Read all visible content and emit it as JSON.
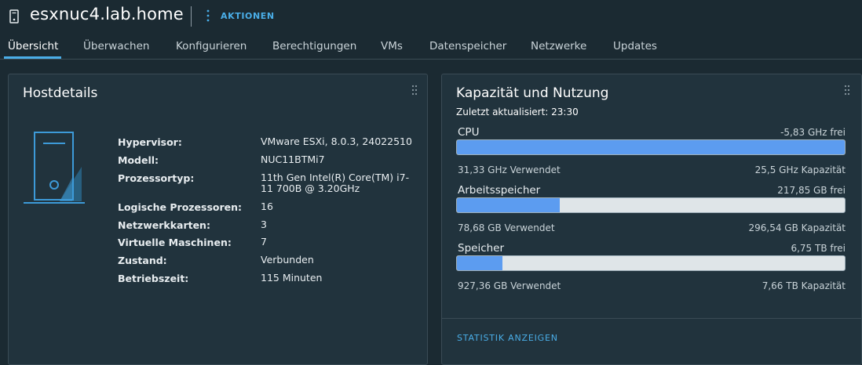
{
  "header": {
    "host_name": "esxnuc4.lab.home",
    "actions_label": "AKTIONEN",
    "icon": "host-icon"
  },
  "tabs": [
    {
      "label": "Übersicht",
      "active": true
    },
    {
      "label": "Überwachen"
    },
    {
      "label": "Konfigurieren"
    },
    {
      "label": "Berechtigungen"
    },
    {
      "label": "VMs"
    },
    {
      "label": "Datenspeicher"
    },
    {
      "label": "Netzwerke"
    },
    {
      "label": "Updates"
    }
  ],
  "host_details": {
    "title": "Hostdetails",
    "rows": [
      {
        "label": "Hypervisor:",
        "value": "VMware ESXi, 8.0.3, 24022510"
      },
      {
        "label": "Modell:",
        "value": "NUC11BTMi7"
      },
      {
        "label": "Prozessortyp:",
        "value": "11th Gen Intel(R) Core(TM) i7-11 700B @ 3.20GHz"
      },
      {
        "label": "Logische Prozessoren:",
        "value": "16"
      },
      {
        "label": "Netzwerkkarten:",
        "value": "3"
      },
      {
        "label": "Virtuelle Maschinen:",
        "value": "7"
      },
      {
        "label": "Zustand:",
        "value": "Verbunden"
      },
      {
        "label": "Betriebszeit:",
        "value": "115 Minuten"
      }
    ]
  },
  "capacity": {
    "title": "Kapazität und Nutzung",
    "updated": "Zuletzt aktualisiert: 23:30",
    "resources": [
      {
        "name": "CPU",
        "free": "-5,83 GHz frei",
        "used": "31,33 GHz Verwendet",
        "capacity": "25,5 GHz Kapazität",
        "usage_fraction": 1.0
      },
      {
        "name": "Arbeitsspeicher",
        "free": "217,85 GB frei",
        "used": "78,68 GB Verwendet",
        "capacity": "296,54 GB Kapazität",
        "usage_fraction": 0.265
      },
      {
        "name": "Speicher",
        "free": "6,75 TB frei",
        "used": "927,36 GB Verwendet",
        "capacity": "7,66 TB Kapazität",
        "usage_fraction": 0.118
      }
    ],
    "footer_link": "STATISTIK ANZEIGEN"
  },
  "colors": {
    "background": "#1b2a32",
    "card": "#21333d",
    "accent": "#4aaee8",
    "bar_fill": "#5c9cf0",
    "bar_track": "#dfe5e8"
  }
}
